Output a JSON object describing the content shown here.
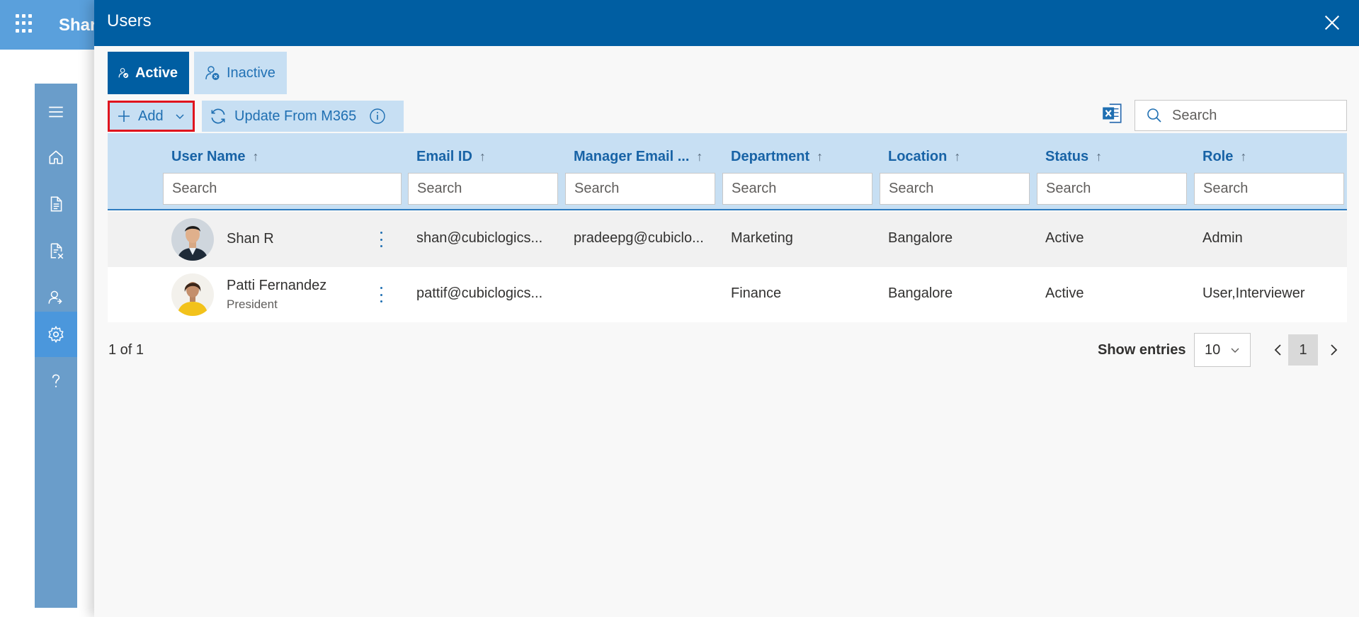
{
  "app": {
    "title": "Shar"
  },
  "sidebar": {
    "items": [
      {
        "icon": "hamburger-icon"
      },
      {
        "icon": "home-icon"
      },
      {
        "icon": "document-icon"
      },
      {
        "icon": "document-cancel-icon"
      },
      {
        "icon": "user-settings-icon"
      },
      {
        "icon": "gear-icon",
        "active": true
      },
      {
        "icon": "help-icon"
      }
    ]
  },
  "panel": {
    "title": "Users",
    "tabs": [
      {
        "label": "Active",
        "active": true
      },
      {
        "label": "Inactive",
        "active": false
      }
    ],
    "toolbar": {
      "add_label": "Add",
      "update_label": "Update From M365"
    },
    "search": {
      "placeholder": "Search"
    }
  },
  "table": {
    "columns": [
      {
        "label": "User Name",
        "filter_placeholder": "Search"
      },
      {
        "label": "Email ID",
        "filter_placeholder": "Search"
      },
      {
        "label": "Manager Email ...",
        "filter_placeholder": "Search"
      },
      {
        "label": "Department",
        "filter_placeholder": "Search"
      },
      {
        "label": "Location",
        "filter_placeholder": "Search"
      },
      {
        "label": "Status",
        "filter_placeholder": "Search"
      },
      {
        "label": "Role",
        "filter_placeholder": "Search"
      }
    ],
    "rows": [
      {
        "name": "Shan R",
        "title": "",
        "email": "shan@cubiclogics...",
        "manager_email": "pradeepg@cubiclo...",
        "department": "Marketing",
        "location": "Bangalore",
        "status": "Active",
        "role": "Admin"
      },
      {
        "name": "Patti Fernandez",
        "title": "President",
        "email": "pattif@cubiclogics...",
        "manager_email": "",
        "department": "Finance",
        "location": "Bangalore",
        "status": "Active",
        "role": "User,Interviewer"
      }
    ]
  },
  "footer": {
    "count_text": "1 of 1",
    "show_entries_label": "Show entries",
    "page_size": "10",
    "current_page": "1"
  },
  "colors": {
    "header_blue": "#005ea2",
    "light_blue": "#c7dff3",
    "highlight_red": "#e0141e"
  }
}
